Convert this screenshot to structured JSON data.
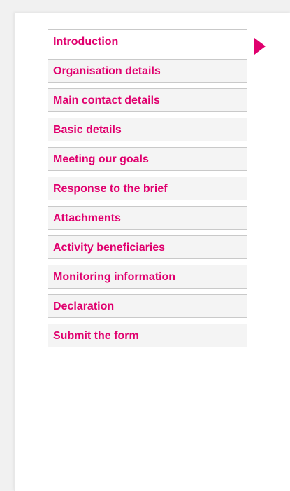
{
  "accent_color": "#e0006e",
  "nav": {
    "active_index": 0,
    "items": [
      {
        "label": "Introduction"
      },
      {
        "label": "Organisation details"
      },
      {
        "label": "Main contact details"
      },
      {
        "label": "Basic details"
      },
      {
        "label": "Meeting our goals"
      },
      {
        "label": "Response to the brief"
      },
      {
        "label": "Attachments"
      },
      {
        "label": "Activity beneficiaries"
      },
      {
        "label": "Monitoring information"
      },
      {
        "label": "Declaration"
      },
      {
        "label": "Submit the form"
      }
    ]
  },
  "icons": {
    "active_indicator": "caret-right-icon"
  }
}
